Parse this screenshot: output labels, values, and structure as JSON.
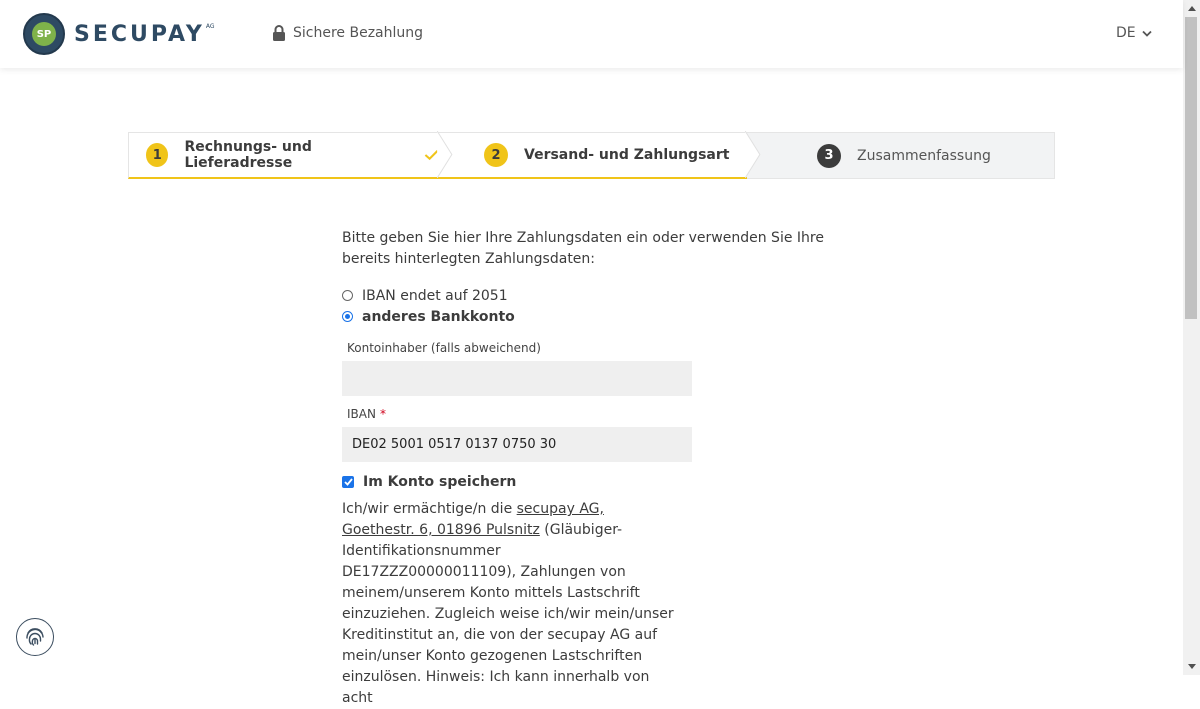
{
  "header": {
    "logo_text": "SECUPAY",
    "logo_suffix": "AG",
    "secure_label": "Sichere Bezahlung",
    "language": "DE"
  },
  "stepper": {
    "steps": [
      {
        "number": "1",
        "label": "Rechnungs- und Lieferadresse",
        "state": "done"
      },
      {
        "number": "2",
        "label": "Versand- und Zahlungsart",
        "state": "active"
      },
      {
        "number": "3",
        "label": "Zusammenfassung",
        "state": "upcoming"
      }
    ]
  },
  "form": {
    "intro": "Bitte geben Sie hier Ihre Zahlungsdaten ein oder verwenden Sie Ihre bereits hinterlegten Zahlungsdaten:",
    "options": [
      {
        "label": "IBAN endet auf 2051",
        "selected": false
      },
      {
        "label": "anderes Bankkonto",
        "selected": true
      }
    ],
    "account_holder_label": "Kontoinhaber (falls abweichend)",
    "account_holder_value": "",
    "iban_label": "IBAN",
    "iban_required_marker": "*",
    "iban_value": "DE02 5001 0517 0137 0750 30",
    "save_account_label": "Im Konto speichern",
    "save_account_checked": true,
    "mandate_prefix": "Ich/wir ermächtige/n die ",
    "mandate_link": "secupay AG, Goethestr. 6, 01896 Pulsnitz",
    "mandate_rest": " (Gläubiger-Identifikationsnummer DE17ZZZ00000011109), Zahlungen von meinem/unserem Konto mittels Lastschrift einzuziehen. Zugleich weise ich/wir mein/unser Kreditinstitut an, die von der secupay AG auf mein/unser Konto gezogenen Lastschriften einzulösen. Hinweis: Ich kann innerhalb von acht"
  },
  "colors": {
    "accent": "#f0c419",
    "brand": "#2e4a63",
    "checkbox": "#1a73e8"
  },
  "icons": {
    "secure": "lock-icon",
    "language": "chevron-down-icon",
    "step_done": "checkmark-icon",
    "floating": "fingerprint-icon"
  }
}
